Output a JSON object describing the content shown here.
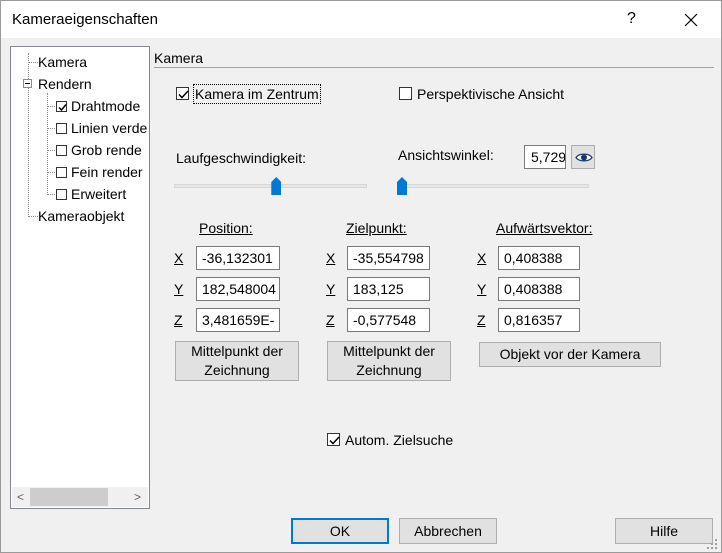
{
  "window": {
    "title": "Kameraeigenschaften",
    "help": "?",
    "icons": {
      "close": "close-icon",
      "help": "help-icon"
    }
  },
  "tree": {
    "items": [
      {
        "label": "Kamera"
      },
      {
        "label": "Rendern"
      },
      {
        "label": "Drahtmode",
        "checked": true
      },
      {
        "label": "Linien verde",
        "checked": false
      },
      {
        "label": "Grob rende",
        "checked": false
      },
      {
        "label": "Fein render",
        "checked": false
      },
      {
        "label": "Erweitert",
        "checked": false
      },
      {
        "label": "Kameraobjekt"
      }
    ],
    "scroll_left": "<",
    "scroll_right": ">"
  },
  "group": {
    "label": "Kamera"
  },
  "options": {
    "camera_center": {
      "label": "Kamera im Zentrum",
      "checked": true
    },
    "perspective": {
      "label": "Perspektivische Ansicht",
      "checked": false
    },
    "auto_target": {
      "label": "Autom. Zielsuche",
      "checked": true
    }
  },
  "speed": {
    "label": "Laufgeschwindigkeit:",
    "value_fraction": 0.53
  },
  "view_angle": {
    "label": "Ansichtswinkel:",
    "value": "5,729",
    "slider_fraction": 0.0,
    "eye_icon": "eye-icon"
  },
  "position": {
    "label": "Position:",
    "x": "-36,132301",
    "y": "182,548004",
    "z": "3,481659E-",
    "button": "Mittelpunkt der Zeichnung"
  },
  "target": {
    "label": "Zielpunkt:",
    "x": "-35,554798",
    "y": "183,125",
    "z": "-0,577548",
    "button": "Mittelpunkt der Zeichnung"
  },
  "up_vector": {
    "label": "Aufwärtsvektor:",
    "x": "0,408388",
    "y": "0,408388",
    "z": "0,816357",
    "button": "Objekt vor der Kamera"
  },
  "axes": {
    "x": "X",
    "y": "Y",
    "z": "Z"
  },
  "footer": {
    "ok": "OK",
    "cancel": "Abbrechen",
    "help": "Hilfe"
  }
}
